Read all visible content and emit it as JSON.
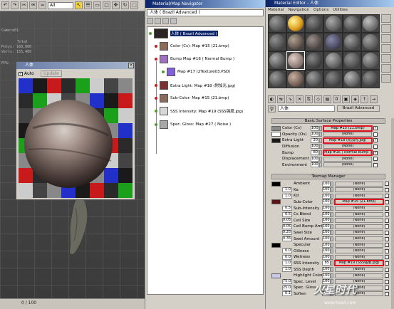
{
  "max": {
    "toolbar_combo": "All",
    "viewport_label": "Camera01",
    "stats": [
      "Total",
      "Polys: 160,000",
      "Verts: 155,400"
    ],
    "fps_label": "FPS:",
    "timeline": "0 / 100"
  },
  "preview": {
    "title": "人体",
    "auto_label": "Auto",
    "update_label": "Update"
  },
  "navigator": {
    "title": "Material/Map Navigator",
    "path": "人体 ( Brazil Advanced )",
    "root": "人体 ( Brazil Advanced )",
    "items": [
      {
        "label": "Color (Cs): Map #15 (21.bmp)",
        "dot": "red",
        "swatch": "#8a6a5a"
      },
      {
        "label": "Bump Map #16 ( Normal Bump )",
        "dot": "red",
        "swatch": "#a070c0"
      },
      {
        "label": "Map #17 (2Texture03.PSD)",
        "dot": "green",
        "swatch": "#8060d8"
      },
      {
        "label": "Extra Light: Map #18 (附加光.jpg)",
        "dot": "red",
        "swatch": "#803030"
      },
      {
        "label": "Sub-Color: Map #15 (21.bmp)",
        "dot": "red",
        "swatch": "#8a6a5a"
      },
      {
        "label": "SSS Intensity: Map #19 (SSS强度.jpg)",
        "dot": "green",
        "swatch": "#d8d8d8"
      },
      {
        "label": "Spec. Gloss: Map #27 ( Noise )",
        "dot": "green",
        "swatch": "#a8a8a8"
      }
    ]
  },
  "editor": {
    "title": "Material Editor - 人体",
    "menu": [
      "Material",
      "Navigation",
      "Options",
      "Utilities"
    ],
    "name": "人体",
    "type": "Brazil Advanced",
    "rollout1": "Basic Surface Properties",
    "rollout2": "Texmap Manager",
    "basic": [
      {
        "label": "Color (Cs)",
        "num": "100",
        "map": "Map #15 (21.bmp)",
        "hl": true,
        "chk": "✓",
        "color": "#8a8a8a"
      },
      {
        "label": "Opacity (Os)",
        "num": "100",
        "map": "(None)",
        "hl": false,
        "chk": "",
        "color": "#ffffff"
      },
      {
        "label": "Extra Light",
        "num": "20",
        "map": "Map #18 (附加光.jpg)",
        "hl": true,
        "chk": "✓",
        "color": "#1a1a1a"
      },
      {
        "label": "Diffusion",
        "num": "100",
        "map": "(None)",
        "hl": false,
        "chk": "",
        "color": ""
      },
      {
        "label": "Bump",
        "num": "80",
        "map": "Map #16 ( Normal Bump )",
        "hl": true,
        "chk": "✓",
        "color": ""
      },
      {
        "label": "Displacement",
        "num": "100",
        "map": "(None)",
        "hl": false,
        "chk": "",
        "color": ""
      },
      {
        "label": "Environment",
        "num": "100",
        "map": "(None)",
        "hl": false,
        "chk": "",
        "color": ""
      }
    ],
    "texmap": [
      {
        "label": "Ambient",
        "num": "100",
        "val": "",
        "map": "(None)",
        "hl": false,
        "color": "#000000"
      },
      {
        "label": "Ka",
        "num": "100",
        "val": "1.0",
        "map": "(None)",
        "hl": false,
        "color": ""
      },
      {
        "label": "Kd",
        "num": "100",
        "val": "1.0",
        "map": "(None)",
        "hl": false,
        "color": ""
      },
      {
        "label": "Sub-Color",
        "num": "100",
        "val": "",
        "map": "Map #15 (21.bmp)",
        "hl": true,
        "color": "#5a1414"
      },
      {
        "label": "Sub-Intensity",
        "num": "100",
        "val": "0.5",
        "map": "(None)",
        "hl": false,
        "color": ""
      },
      {
        "label": "Cs Blend",
        "num": "100",
        "val": "0.5",
        "map": "(None)",
        "hl": false,
        "color": ""
      },
      {
        "label": "Cell Size",
        "num": "100",
        "val": "0.05",
        "map": "(None)",
        "hl": false,
        "color": ""
      },
      {
        "label": "Cell Bump Amt",
        "num": "100",
        "val": "0.05",
        "map": "(None)",
        "hl": false,
        "color": ""
      },
      {
        "label": "Swel Size",
        "num": "100",
        "val": "0.25",
        "map": "(None)",
        "hl": false,
        "color": ""
      },
      {
        "label": "Swel Amount",
        "num": "100",
        "val": "0.35",
        "map": "(None)",
        "hl": false,
        "color": ""
      },
      {
        "label": "Specular",
        "num": "100",
        "val": "",
        "map": "(None)",
        "hl": false,
        "color": "#000000"
      },
      {
        "label": "Oiliness",
        "num": "100",
        "val": "0.0",
        "map": "(None)",
        "hl": false,
        "color": ""
      },
      {
        "label": "Wetness",
        "num": "100",
        "val": "0.0",
        "map": "(None)",
        "hl": false,
        "color": ""
      },
      {
        "label": "SSS Intensity",
        "num": "85",
        "val": "1.0",
        "map": "Map #19 (SSS强度.jpg)",
        "hl": true,
        "color": ""
      },
      {
        "label": "SSS Depth",
        "num": "100",
        "val": "1.0",
        "map": "(None)",
        "hl": false,
        "color": ""
      },
      {
        "label": "Highlight Color",
        "num": "100",
        "val": "",
        "map": "(None)",
        "hl": false,
        "color": "#c8c8e8"
      },
      {
        "label": "Spec. Level",
        "num": "100",
        "val": "75.0",
        "map": "(None)",
        "hl": false,
        "color": ""
      },
      {
        "label": "Spec. Gloss",
        "num": "100",
        "val": "25.0",
        "map": "(None)",
        "hl": false,
        "color": ""
      },
      {
        "label": "Soften",
        "num": "100",
        "val": "0.1",
        "map": "(None)",
        "hl": false,
        "color": ""
      }
    ]
  },
  "watermark": {
    "text": "火星时代",
    "url": "www.hxsd.com"
  }
}
